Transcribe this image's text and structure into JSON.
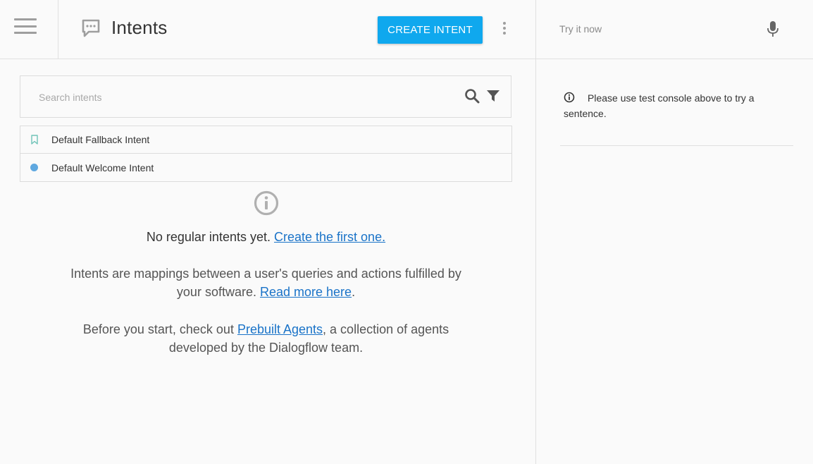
{
  "header": {
    "title": "Intents",
    "create_button_label": "CREATE INTENT",
    "menu_icon": "hamburger-icon",
    "title_icon": "chat-bubble-icon",
    "more_icon": "more-vertical-icon"
  },
  "search": {
    "placeholder": "Search intents",
    "value": ""
  },
  "intents": [
    {
      "label": "Default Fallback Intent",
      "icon": "bookmark-icon"
    },
    {
      "label": "Default Welcome Intent",
      "icon": "dot-icon"
    }
  ],
  "empty_state": {
    "title_text": "No regular intents yet.",
    "title_link": "Create the first one.",
    "para1_text": "Intents are mappings between a user's queries and actions fulfilled by your software.",
    "para1_link": "Read more here",
    "para1_suffix": ".",
    "para2_prefix": "Before you start, check out",
    "para2_link": "Prebuilt Agents",
    "para2_suffix": ", a collection of agents developed by the Dialogflow team."
  },
  "console": {
    "placeholder": "Try it now",
    "value": "",
    "message": "Please use test console above to try a sentence."
  },
  "colors": {
    "accent": "#0fa8ee",
    "link": "#1a73c8",
    "dot": "#5fa8e0",
    "bookmark": "#6fc3b8"
  }
}
